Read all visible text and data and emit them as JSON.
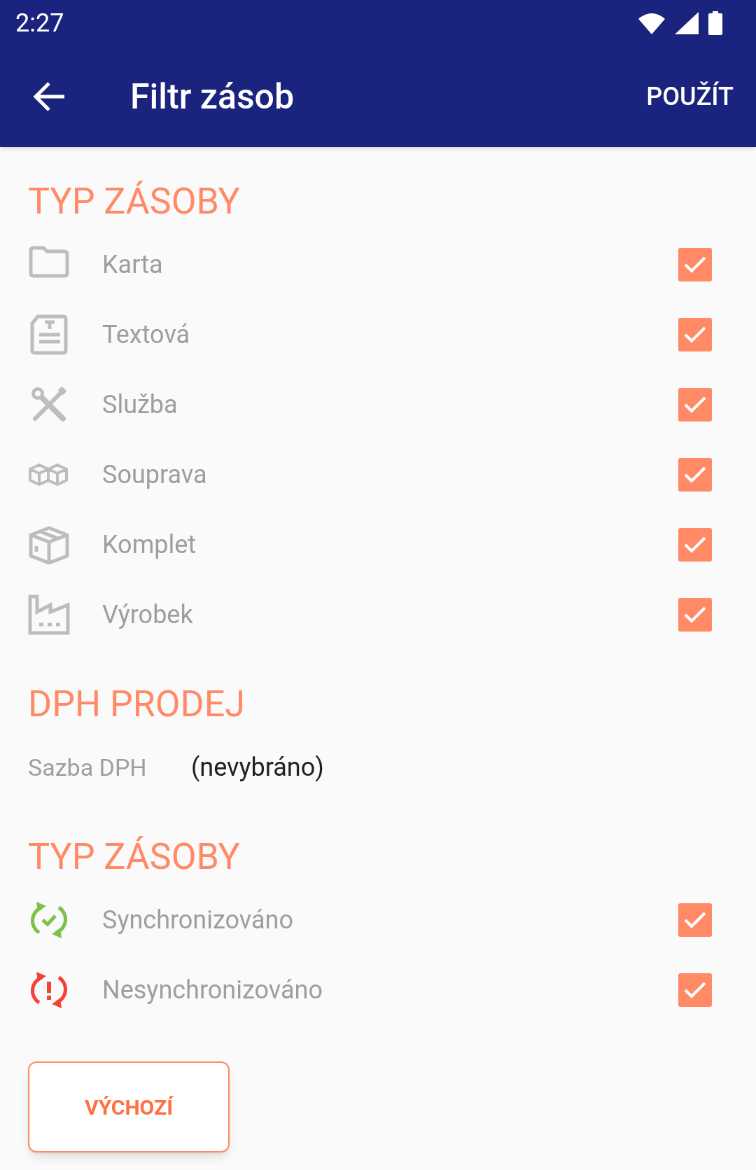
{
  "status_bar": {
    "time": "2:27"
  },
  "app_bar": {
    "title": "Filtr zásob",
    "action": "POUŽÍT"
  },
  "sections": [
    {
      "kind": "checklist",
      "title": "TYP ZÁSOBY",
      "items": [
        {
          "label": "Karta",
          "checked": true
        },
        {
          "label": "Textová",
          "checked": true
        },
        {
          "label": "Služba",
          "checked": true
        },
        {
          "label": "Souprava",
          "checked": true
        },
        {
          "label": "Komplet",
          "checked": true
        },
        {
          "label": "Výrobek",
          "checked": true
        }
      ]
    },
    {
      "kind": "fields",
      "title": "DPH PRODEJ",
      "fields": [
        {
          "label": "Sazba DPH",
          "value": "(nevybráno)"
        }
      ]
    },
    {
      "kind": "checklist",
      "title": "TYP ZÁSOBY",
      "items": [
        {
          "label": "Synchronizováno",
          "checked": true
        },
        {
          "label": "Nesynchronizováno",
          "checked": true
        }
      ]
    }
  ],
  "default_button": "VÝCHOZÍ"
}
